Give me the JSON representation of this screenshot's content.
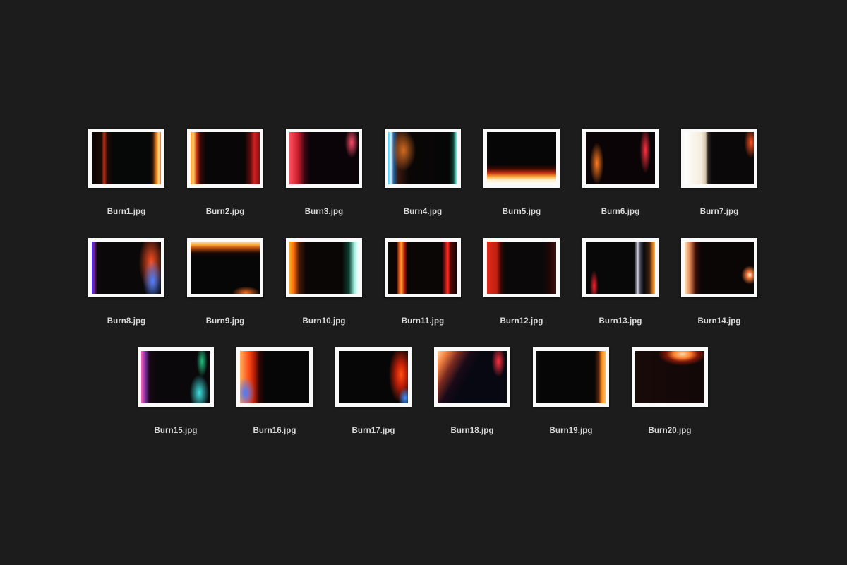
{
  "files": [
    {
      "name": "Burn1.jpg"
    },
    {
      "name": "Burn2.jpg"
    },
    {
      "name": "Burn3.jpg"
    },
    {
      "name": "Burn4.jpg"
    },
    {
      "name": "Burn5.jpg"
    },
    {
      "name": "Burn6.jpg"
    },
    {
      "name": "Burn7.jpg"
    },
    {
      "name": "Burn8.jpg"
    },
    {
      "name": "Burn9.jpg"
    },
    {
      "name": "Burn10.jpg"
    },
    {
      "name": "Burn11.jpg"
    },
    {
      "name": "Burn12.jpg"
    },
    {
      "name": "Burn13.jpg"
    },
    {
      "name": "Burn14.jpg"
    },
    {
      "name": "Burn15.jpg"
    },
    {
      "name": "Burn16.jpg"
    },
    {
      "name": "Burn17.jpg"
    },
    {
      "name": "Burn18.jpg"
    },
    {
      "name": "Burn19.jpg"
    },
    {
      "name": "Burn20.jpg"
    }
  ]
}
